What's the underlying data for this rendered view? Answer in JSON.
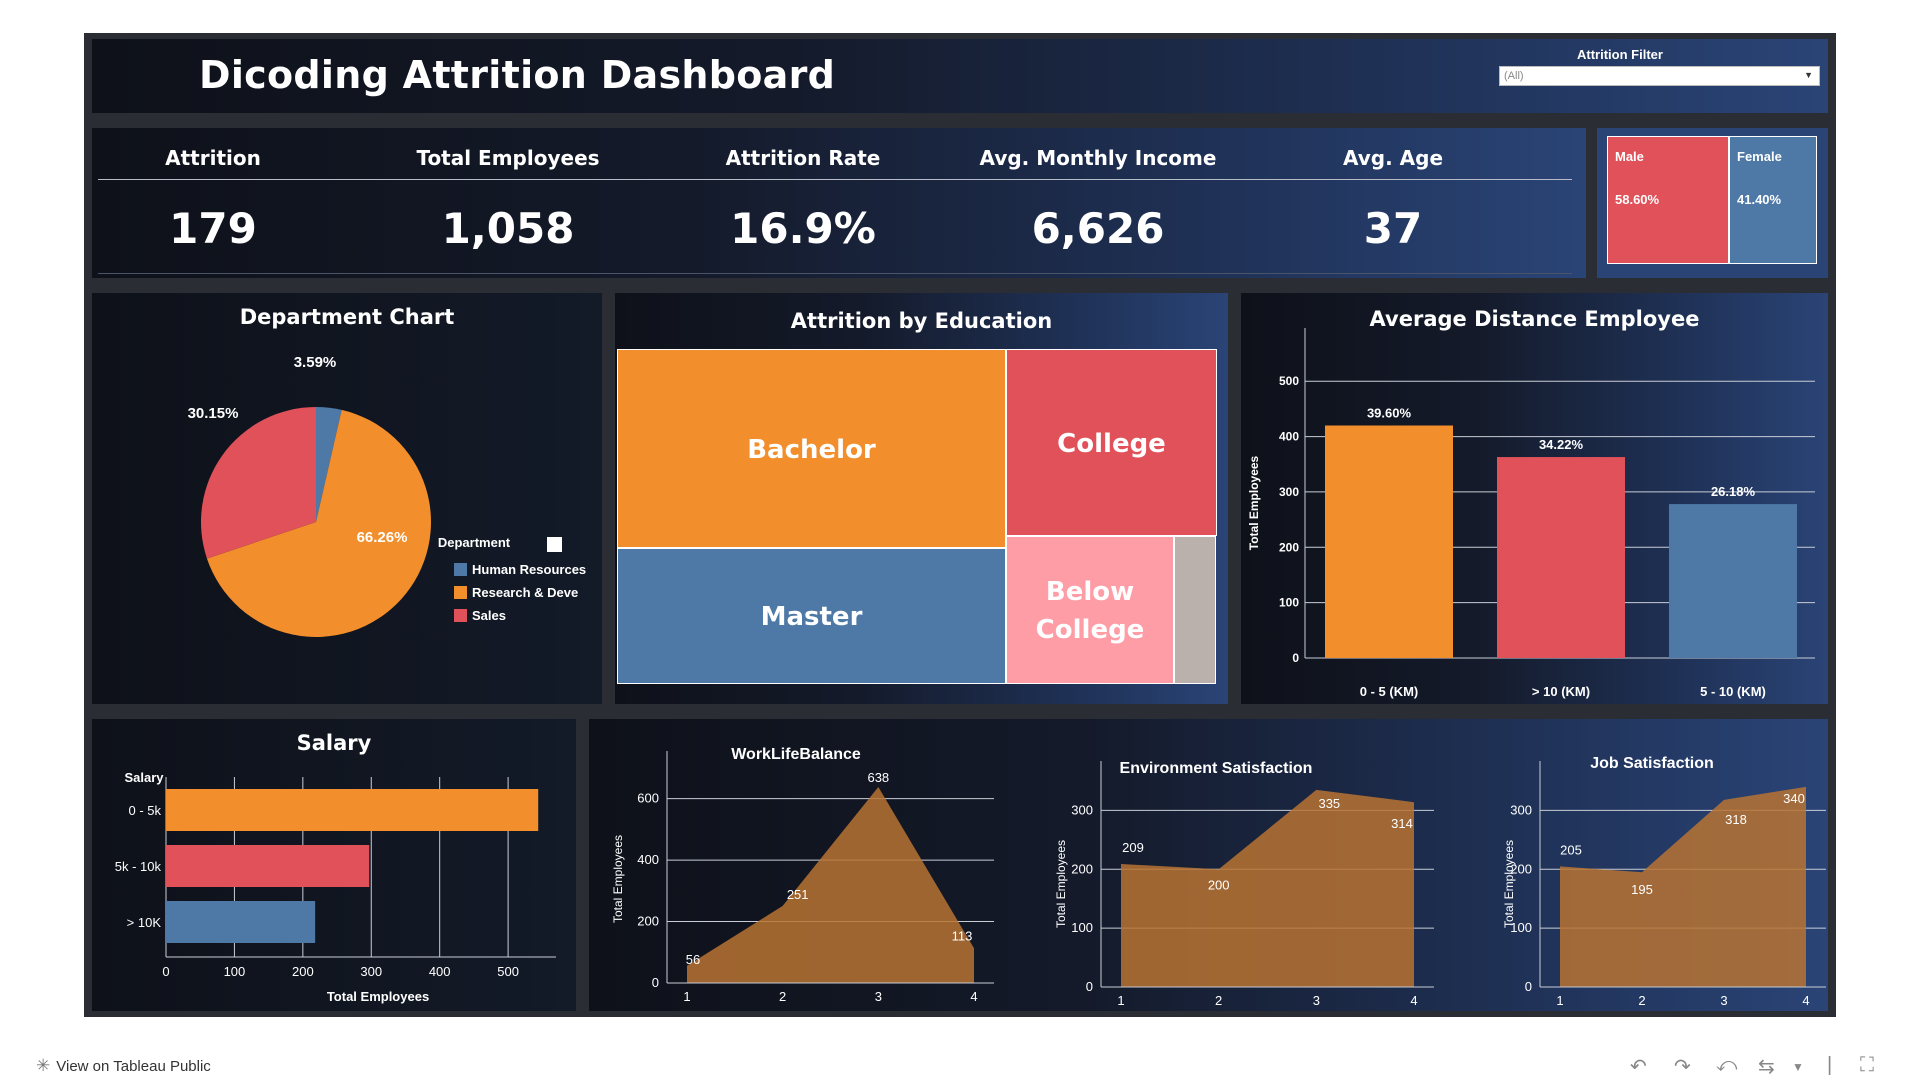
{
  "header": {
    "title": "Dicoding Attrition Dashboard",
    "filter_label": "Attrition Filter",
    "filter_value": "(All)"
  },
  "kpis": [
    {
      "label": "Attrition",
      "value": "179"
    },
    {
      "label": "Total Employees",
      "value": "1,058"
    },
    {
      "label": "Attrition Rate",
      "value": "16.9%"
    },
    {
      "label": "Avg. Monthly Income",
      "value": "6,626"
    },
    {
      "label": "Avg. Age",
      "value": "37"
    }
  ],
  "gender": {
    "male_label": "Male",
    "male_pct": "58.60%",
    "female_label": "Female",
    "female_pct": "41.40%"
  },
  "colors": {
    "orange": "#f28e2b",
    "red": "#e05159",
    "blue": "#4e79a7",
    "pink": "#ff9da7",
    "gray": "#bab0ac",
    "area": "#b87333"
  },
  "department": {
    "title": "Department Chart",
    "legend_title": "Department",
    "slice_labels": [
      "3.59%",
      "66.26%",
      "30.15%"
    ]
  },
  "education": {
    "title": "Attrition by Education"
  },
  "distance": {
    "title": "Average Distance Employee"
  },
  "salary": {
    "title": "Salary"
  },
  "bottom": {
    "tableau_link": "View on Tableau Public"
  },
  "chart_data": [
    {
      "type": "pie",
      "title": "Department Chart",
      "legend_title": "Department",
      "categories": [
        "Human Resources",
        "Research & Deve",
        "Sales"
      ],
      "values": [
        3.59,
        66.26,
        30.15
      ],
      "labels": [
        "3.59%",
        "66.26%",
        "30.15%"
      ],
      "colors": [
        "#4e79a7",
        "#f28e2b",
        "#e05159"
      ]
    },
    {
      "type": "treemap",
      "title": "Attrition by Education",
      "categories": [
        "Bachelor",
        "College",
        "Master",
        "Below College",
        ""
      ],
      "colors": [
        "#f28e2b",
        "#e05159",
        "#4e79a7",
        "#ff9da7",
        "#bab0ac"
      ]
    },
    {
      "type": "bar",
      "title": "Average Distance Employee",
      "categories": [
        "0 - 5 (KM)",
        "> 10 (KM)",
        "5 - 10 (KM)"
      ],
      "values": [
        420,
        363,
        278
      ],
      "data_labels": [
        "39.60%",
        "34.22%",
        "26.18%"
      ],
      "ylabel": "Total Employees",
      "yticks": [
        0,
        100,
        200,
        300,
        400,
        500
      ],
      "ylim": [
        0,
        560
      ],
      "colors": [
        "#f28e2b",
        "#e05159",
        "#4e79a7"
      ]
    },
    {
      "type": "bar",
      "orientation": "horizontal",
      "title": "Salary",
      "category_axis_label": "Salary",
      "categories": [
        "0 - 5k",
        "5k - 10k",
        "> 10K"
      ],
      "values": [
        544,
        297,
        218
      ],
      "xlabel": "Total Employees",
      "xticks": [
        0,
        100,
        200,
        300,
        400,
        500
      ],
      "xlim": [
        0,
        570
      ],
      "colors": [
        "#f28e2b",
        "#e05159",
        "#4e79a7"
      ]
    },
    {
      "type": "area",
      "title": "WorkLifeBalance",
      "x": [
        1,
        2,
        3,
        4
      ],
      "values": [
        56,
        251,
        638,
        113
      ],
      "ylabel": "Total Employees",
      "yticks": [
        0,
        200,
        400,
        600
      ],
      "ylim": [
        0,
        690
      ]
    },
    {
      "type": "area",
      "title": "Environment Satisfaction",
      "x": [
        1,
        2,
        3,
        4
      ],
      "values": [
        209,
        200,
        335,
        314
      ],
      "ylabel": "Total Employees",
      "yticks": [
        0,
        100,
        200,
        300
      ],
      "ylim": [
        0,
        350
      ]
    },
    {
      "type": "area",
      "title": "Job Satisfaction",
      "x": [
        1,
        2,
        3,
        4
      ],
      "values": [
        205,
        195,
        318,
        340
      ],
      "ylabel": "Total Employees",
      "yticks": [
        0,
        100,
        200,
        300
      ],
      "ylim": [
        0,
        350
      ]
    }
  ]
}
